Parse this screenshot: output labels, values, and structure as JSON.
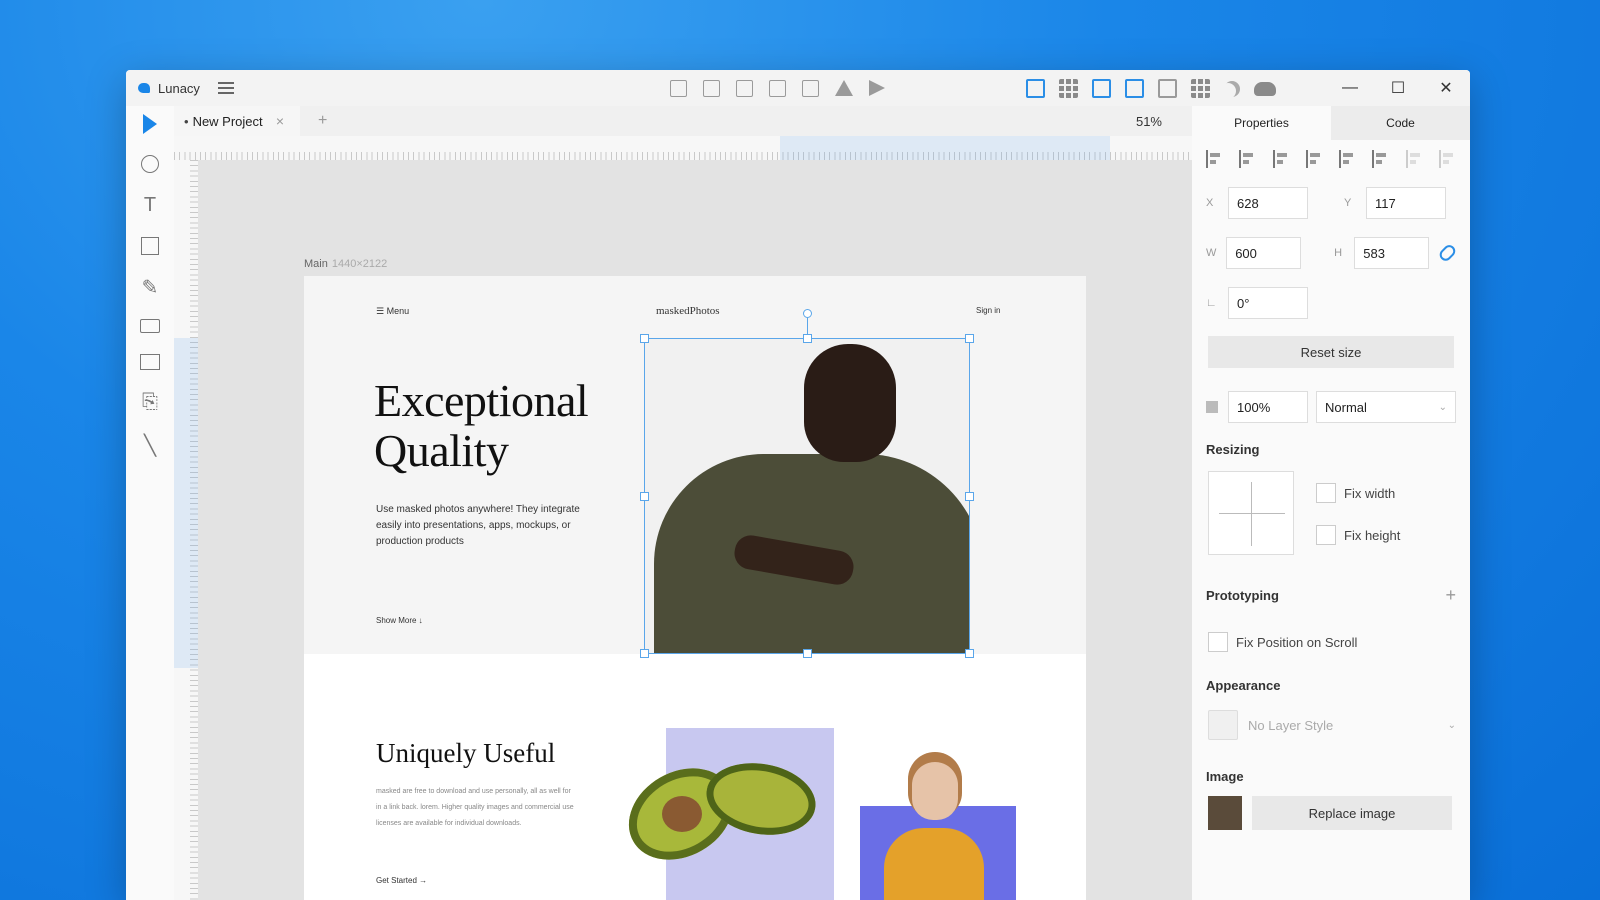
{
  "app": {
    "title": "Lunacy",
    "accent": "#1a86e8"
  },
  "tabs": {
    "doc_dot": "•",
    "doc_name": "New Project",
    "close": "×",
    "add": "+",
    "zoom": "51%"
  },
  "window_controls": {
    "minimize": "—",
    "maximize": "☐",
    "close": "✕"
  },
  "canvas": {
    "frame_name": "Main",
    "frame_dims": "1440×2122",
    "hero": {
      "menu": "☰ Menu",
      "logo": "maskedPhotos",
      "sign_in": "Sign in",
      "title_line1": "Exceptional",
      "title_line2": "Quality",
      "description": "Use masked photos anywhere! They integrate easily into presentations, apps, mockups, or production products",
      "more": "Show More ↓"
    },
    "section2": {
      "title": "Uniquely Useful",
      "description": "masked are free to download and use personally, all as well for in a link back. lorem. Higher quality images and commercial use licenses are available for individual downloads.",
      "more": "Get Started →"
    }
  },
  "panel": {
    "tab_properties": "Properties",
    "tab_code": "Code",
    "x_label": "X",
    "x_value": "628",
    "y_label": "Y",
    "y_value": "117",
    "w_label": "W",
    "w_value": "600",
    "h_label": "H",
    "h_value": "583",
    "angle_label": "∟",
    "angle_value": "0°",
    "reset_size": "Reset size",
    "opacity": "100%",
    "blend": "Normal",
    "resizing_title": "Resizing",
    "fix_width": "Fix width",
    "fix_height": "Fix height",
    "prototyping_title": "Prototyping",
    "prototyping_add": "+",
    "fix_position": "Fix Position on Scroll",
    "appearance_title": "Appearance",
    "layer_style": "No Layer Style",
    "image_title": "Image",
    "replace_image": "Replace image"
  }
}
